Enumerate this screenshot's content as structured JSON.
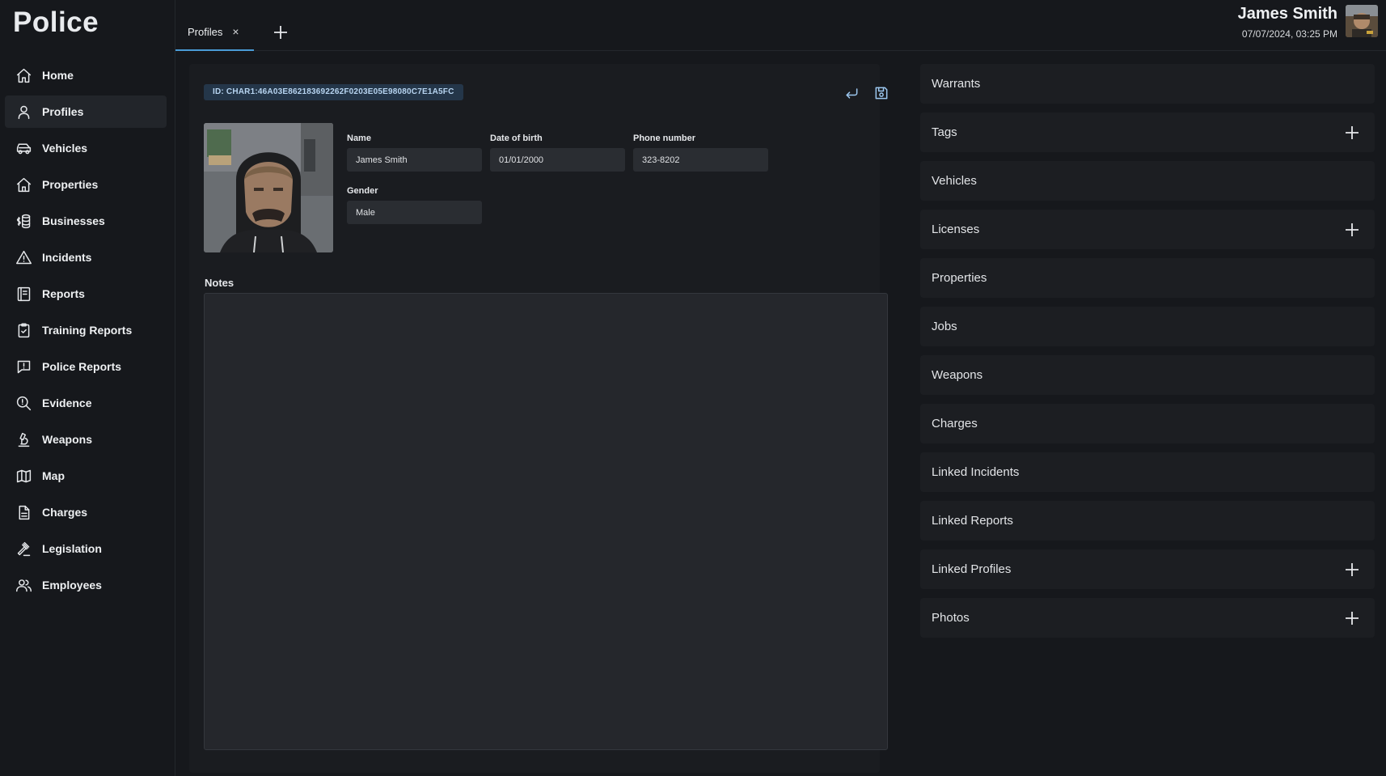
{
  "app": {
    "title": "Police"
  },
  "sidebar": {
    "items": [
      {
        "label": "Home",
        "icon": "home-icon",
        "active": false
      },
      {
        "label": "Profiles",
        "icon": "user-icon",
        "active": true
      },
      {
        "label": "Vehicles",
        "icon": "car-icon",
        "active": false
      },
      {
        "label": "Properties",
        "icon": "house-icon",
        "active": false
      },
      {
        "label": "Businesses",
        "icon": "coins-icon",
        "active": false
      },
      {
        "label": "Incidents",
        "icon": "warning-icon",
        "active": false
      },
      {
        "label": "Reports",
        "icon": "report-icon",
        "active": false
      },
      {
        "label": "Training Reports",
        "icon": "clipboard-icon",
        "active": false
      },
      {
        "label": "Police Reports",
        "icon": "message-alert-icon",
        "active": false
      },
      {
        "label": "Evidence",
        "icon": "magnifier-alert-icon",
        "active": false
      },
      {
        "label": "Weapons",
        "icon": "microscope-icon",
        "active": false
      },
      {
        "label": "Map",
        "icon": "map-icon",
        "active": false
      },
      {
        "label": "Charges",
        "icon": "document-icon",
        "active": false
      },
      {
        "label": "Legislation",
        "icon": "gavel-icon",
        "active": false
      },
      {
        "label": "Employees",
        "icon": "users-icon",
        "active": false
      }
    ]
  },
  "tabs": [
    {
      "label": "Profiles",
      "active": true,
      "close": "×"
    }
  ],
  "user": {
    "name": "James Smith",
    "datetime": "07/07/2024, 03:25 PM"
  },
  "profile": {
    "id": "ID: CHAR1:46A03E862183692262F0203E05E98080C7E1A5FC",
    "fields": {
      "name": {
        "label": "Name",
        "value": "James Smith"
      },
      "dob": {
        "label": "Date of birth",
        "value": "01/01/2000"
      },
      "phone": {
        "label": "Phone number",
        "value": "323-8202"
      },
      "gender": {
        "label": "Gender",
        "value": "Male"
      }
    },
    "notes": {
      "label": "Notes",
      "value": ""
    }
  },
  "sections": [
    {
      "title": "Warrants",
      "addable": false
    },
    {
      "title": "Tags",
      "addable": true
    },
    {
      "title": "Vehicles",
      "addable": false
    },
    {
      "title": "Licenses",
      "addable": true
    },
    {
      "title": "Properties",
      "addable": false
    },
    {
      "title": "Jobs",
      "addable": false
    },
    {
      "title": "Weapons",
      "addable": false
    },
    {
      "title": "Charges",
      "addable": false
    },
    {
      "title": "Linked Incidents",
      "addable": false
    },
    {
      "title": "Linked Reports",
      "addable": false
    },
    {
      "title": "Linked Profiles",
      "addable": true
    },
    {
      "title": "Photos",
      "addable": true
    }
  ],
  "colors": {
    "background": "#16181c",
    "panel": "#1a1c20",
    "accent": "#4a9bd6",
    "badge": "#243649"
  }
}
